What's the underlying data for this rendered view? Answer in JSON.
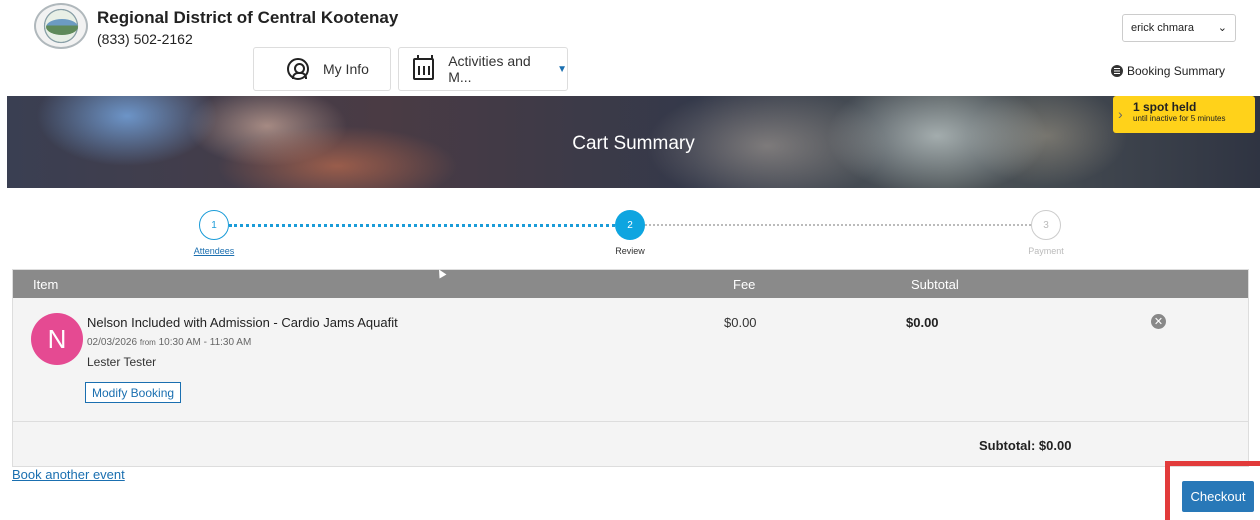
{
  "header": {
    "org_name": "Regional District of Central Kootenay",
    "phone": "(833) 502-2162",
    "user_select_value": "erick chmara",
    "nav": {
      "my_info": "My Info",
      "activities": "Activities and M..."
    },
    "booking_summary": "Booking Summary"
  },
  "banner": {
    "title": "Cart Summary",
    "hold_title": "1 spot held",
    "hold_subtitle": "until inactive for 5 minutes",
    "accent_color": "#ffd21a"
  },
  "stepper": {
    "current_step": 2,
    "steps": [
      {
        "number": "1",
        "label": "Attendees"
      },
      {
        "number": "2",
        "label": "Review"
      },
      {
        "number": "3",
        "label": "Payment"
      }
    ]
  },
  "cart": {
    "columns": {
      "item": "Item",
      "fee": "Fee",
      "subtotal": "Subtotal"
    },
    "items": [
      {
        "avatar_letter": "N",
        "avatar_color": "#e54a92",
        "title": "Nelson Included with Admission - Cardio Jams Aquafit",
        "date": "02/03/2026",
        "from_word": "from",
        "time": "10:30 AM - 11:30 AM",
        "person": "Lester Tester",
        "modify_label": "Modify Booking",
        "fee": "$0.00",
        "subtotal": "$0.00"
      }
    ],
    "total_label": "Subtotal: $0.00"
  },
  "footer": {
    "book_another": "Book another event",
    "checkout": "Checkout",
    "checkout_color": "#2878b8"
  },
  "icons": [
    "logo",
    "person-icon",
    "calendar-icon",
    "list-icon",
    "remove-icon",
    "chevron-down-icon"
  ]
}
